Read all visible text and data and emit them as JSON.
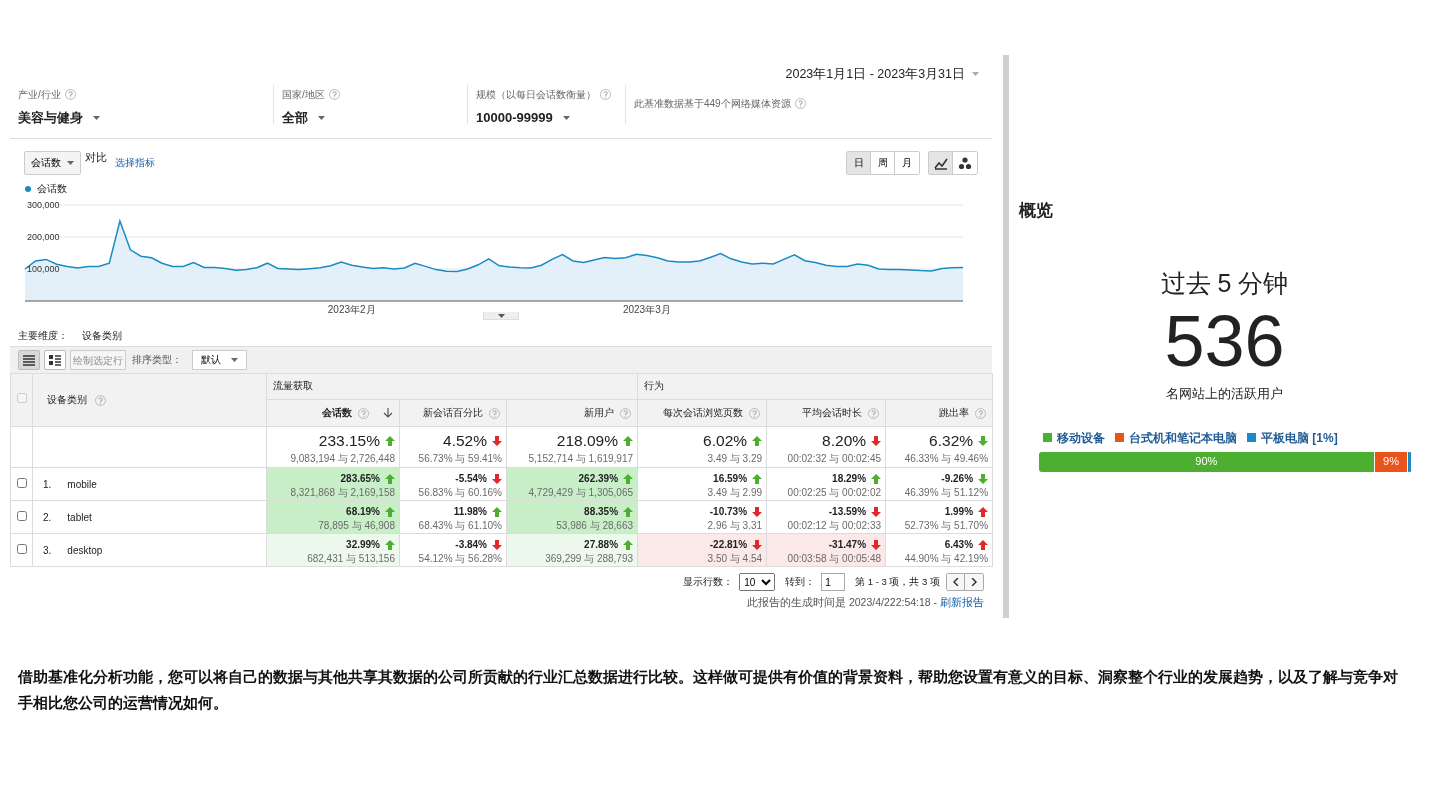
{
  "date_range": {
    "label": "2023年1月1日 - 2023年3月31日"
  },
  "filters": [
    {
      "kind": "select",
      "label": "产业/行业",
      "value": "美容与健身"
    },
    {
      "kind": "select",
      "label": "国家/地区",
      "value": "全部"
    },
    {
      "kind": "select",
      "label": "规模（以每日会话数衡量）",
      "value": "10000-99999"
    },
    {
      "kind": "note",
      "label": "此基准数据基于449个网络媒体资源"
    }
  ],
  "metric_bar": {
    "metric": "会话数",
    "compare_label": "对比",
    "pick_link": "选择指标",
    "periods": [
      {
        "label": "日",
        "selected": true
      },
      {
        "label": "周",
        "selected": false
      },
      {
        "label": "月",
        "selected": false
      }
    ],
    "chart_types": [
      {
        "kind": "line",
        "selected": true
      },
      {
        "kind": "bubble",
        "selected": false
      }
    ]
  },
  "chart": {
    "chart_data": {
      "type": "area",
      "ylim": [
        0,
        300000
      ],
      "categories": [
        null,
        null,
        null,
        null,
        null,
        null,
        null,
        null,
        null,
        null,
        null,
        null,
        null,
        null,
        null,
        null,
        null,
        null,
        null,
        null,
        null,
        null,
        null,
        null,
        null,
        null,
        null,
        null,
        null,
        null,
        null,
        "2023年2月",
        null,
        null,
        null,
        null,
        null,
        null,
        null,
        null,
        null,
        null,
        null,
        null,
        null,
        null,
        null,
        null,
        null,
        null,
        null,
        null,
        null,
        null,
        null,
        null,
        null,
        null,
        null,
        "2023年3月",
        null,
        null,
        null,
        null,
        null,
        null,
        null,
        null,
        null,
        null,
        null,
        null,
        null,
        null,
        null,
        null,
        null,
        null,
        null,
        null,
        null,
        null,
        null,
        null,
        null,
        null,
        null,
        null,
        null,
        null
      ],
      "yticks": [
        {
          "value": 100000,
          "label": "100,000"
        },
        {
          "value": 200000,
          "label": "200,000"
        },
        {
          "value": 300000,
          "label": "300,000"
        }
      ],
      "series": [
        {
          "name": "会话数",
          "color": "#1a8ac4",
          "values": [
            100000,
            125000,
            130000,
            115000,
            108000,
            103000,
            108000,
            108000,
            118000,
            250000,
            160000,
            140000,
            135000,
            118000,
            108000,
            108000,
            120000,
            105000,
            105000,
            102000,
            96000,
            98000,
            104000,
            118000,
            102000,
            100000,
            98000,
            101000,
            104000,
            110000,
            122000,
            112000,
            106000,
            102000,
            104000,
            100000,
            103000,
            118000,
            108000,
            98000,
            93000,
            92000,
            100000,
            113000,
            132000,
            110000,
            106000,
            104000,
            103000,
            112000,
            130000,
            145000,
            125000,
            120000,
            128000,
            136000,
            133000,
            135000,
            146000,
            142000,
            135000,
            125000,
            122000,
            122000,
            125000,
            136000,
            148000,
            132000,
            122000,
            116000,
            118000,
            116000,
            130000,
            144000,
            126000,
            120000,
            112000,
            108000,
            108000,
            116000,
            112000,
            100000,
            98000,
            98000,
            97000,
            95000,
            94000,
            102000,
            104000,
            105000
          ]
        }
      ]
    }
  },
  "dimension": {
    "label": "主要维度：",
    "value": "设备类别"
  },
  "toolbar": {
    "views": [
      {
        "kind": "table",
        "selected": true
      },
      {
        "kind": "pivot",
        "selected": false
      }
    ],
    "plot_button": {
      "label": "绘制选定行",
      "disabled": true
    },
    "sort_label": "排序类型：",
    "sort_value": "默认"
  },
  "table": {
    "header_checkbox": {
      "checked": false
    },
    "dimension_column": "设备类别",
    "groups": [
      {
        "label": "流量获取"
      },
      {
        "label": "行为"
      }
    ],
    "columns": [
      {
        "label": "会话数",
        "sorted": true
      },
      {
        "label": "新会话百分比",
        "sorted": false
      },
      {
        "label": "新用户",
        "sorted": false
      },
      {
        "label": "每次会话浏览页数",
        "sorted": false
      },
      {
        "label": "平均会话时长",
        "sorted": false
      },
      {
        "label": "跳出率",
        "sorted": false
      }
    ],
    "totals": [
      {
        "value": "233.15%",
        "rising": true,
        "good": true,
        "compare": "9,083,194 与 2,726,448"
      },
      {
        "value": "4.52%",
        "rising": false,
        "good": false,
        "compare": "56.73% 与 59.41%"
      },
      {
        "value": "218.09%",
        "rising": true,
        "good": true,
        "compare": "5,152,714 与 1,619,917"
      },
      {
        "value": "6.02%",
        "rising": true,
        "good": true,
        "compare": "3.49 与 3.29"
      },
      {
        "value": "8.20%",
        "rising": false,
        "good": false,
        "compare": "00:02:32 与 00:02:45"
      },
      {
        "value": "6.32%",
        "rising": false,
        "good": true,
        "compare": "46.33% 与 49.46%"
      }
    ],
    "rows": [
      {
        "checked": false,
        "index": "1.",
        "name": "mobile",
        "cells": [
          {
            "value": "283.65%",
            "rising": true,
            "good": true,
            "highlighted": true,
            "strong": true,
            "compare": "8,321,868 与 2,169,158"
          },
          {
            "value": "-5.54%",
            "rising": false,
            "good": false,
            "highlighted": false,
            "compare": "56.83% 与 60.16%"
          },
          {
            "value": "262.39%",
            "rising": true,
            "good": true,
            "highlighted": true,
            "strong": true,
            "compare": "4,729,429 与 1,305,065"
          },
          {
            "value": "16.59%",
            "rising": true,
            "good": true,
            "highlighted": false,
            "compare": "3.49 与 2.99"
          },
          {
            "value": "18.29%",
            "rising": true,
            "good": true,
            "highlighted": false,
            "compare": "00:02:25 与 00:02:02"
          },
          {
            "value": "-9.26%",
            "rising": false,
            "good": true,
            "highlighted": false,
            "compare": "46.39% 与 51.12%"
          }
        ]
      },
      {
        "checked": false,
        "index": "2.",
        "name": "tablet",
        "cells": [
          {
            "value": "68.19%",
            "rising": true,
            "good": true,
            "highlighted": true,
            "strong": true,
            "compare": "78,895 与 46,908"
          },
          {
            "value": "11.98%",
            "rising": true,
            "good": true,
            "highlighted": false,
            "compare": "68.43% 与 61.10%"
          },
          {
            "value": "88.35%",
            "rising": true,
            "good": true,
            "highlighted": true,
            "strong": true,
            "compare": "53,986 与 28,663"
          },
          {
            "value": "-10.73%",
            "rising": false,
            "good": false,
            "highlighted": false,
            "compare": "2.96 与 3.31"
          },
          {
            "value": "-13.59%",
            "rising": false,
            "good": false,
            "highlighted": false,
            "compare": "00:02:12 与 00:02:33"
          },
          {
            "value": "1.99%",
            "rising": true,
            "good": false,
            "highlighted": false,
            "compare": "52.73% 与 51.70%"
          }
        ]
      },
      {
        "checked": false,
        "index": "3.",
        "name": "desktop",
        "cells": [
          {
            "value": "32.99%",
            "rising": true,
            "good": true,
            "highlighted": true,
            "strong": false,
            "compare": "682,431 与 513,156"
          },
          {
            "value": "-3.84%",
            "rising": false,
            "good": false,
            "highlighted": false,
            "compare": "54.12% 与 56.28%"
          },
          {
            "value": "27.88%",
            "rising": true,
            "good": true,
            "highlighted": true,
            "strong": false,
            "compare": "369,299 与 288,793"
          },
          {
            "value": "-22.81%",
            "rising": false,
            "good": false,
            "highlighted": true,
            "strong": false,
            "compare": "3.50 与 4.54"
          },
          {
            "value": "-31.47%",
            "rising": false,
            "good": false,
            "highlighted": true,
            "strong": false,
            "compare": "00:03:58 与 00:05:48"
          },
          {
            "value": "6.43%",
            "rising": true,
            "good": false,
            "highlighted": false,
            "compare": "44.90% 与 42.19%"
          }
        ]
      }
    ]
  },
  "pagination": {
    "rows_label": "显示行数：",
    "rows_value": "10",
    "goto_label": "转到：",
    "goto_value": "1",
    "range": "第 1 - 3 项，共 3 项"
  },
  "footer": {
    "text": "此报告的生成时间是 2023/4/222:54:18 - ",
    "link": "刷新报告"
  },
  "overview": {
    "title": "概览",
    "period": "过去 5 分钟",
    "count": "536",
    "count_label": "名网站上的活跃用户",
    "devices": [
      {
        "name": "移动设备",
        "color": "#4caf2f",
        "level": 0.9,
        "reading": "90%"
      },
      {
        "name": "台式机和笔记本电脑",
        "color": "#e8541c",
        "level": 0.09,
        "reading": "9%"
      },
      {
        "name": "平板电脑 [1%]",
        "color": "#1a88c9",
        "level": 0.01
      }
    ]
  },
  "caption": "借助基准化分析功能，您可以将自己的数据与其他共享其数据的公司所贡献的行业汇总数据进行比较。这样做可提供有价值的背景资料，帮助您设置有意义的目标、洞察整个行业的发展趋势，以及了解与竞争对手相比您公司的运营情况如何。"
}
